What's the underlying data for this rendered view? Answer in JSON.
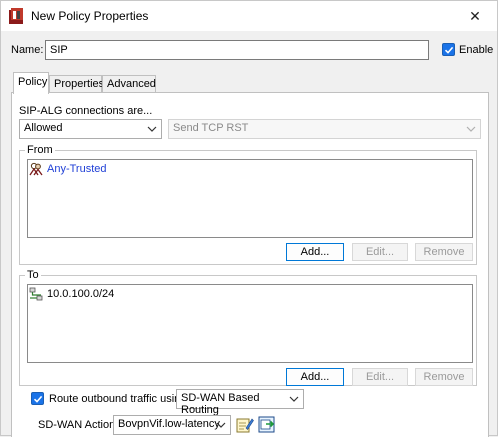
{
  "window": {
    "title": "New Policy Properties",
    "close_glyph": "✕",
    "app_icon": "policy-app-icon"
  },
  "name_field": {
    "label": "Name:",
    "value": "SIP"
  },
  "enable": {
    "label": "Enable",
    "checked": true
  },
  "tabs": [
    {
      "label": "Policy",
      "active": true
    },
    {
      "label": "Properties",
      "active": false
    },
    {
      "label": "Advanced",
      "active": false
    }
  ],
  "policy": {
    "alg_label": "SIP-ALG connections are...",
    "connection_action": "Allowed",
    "tcp_rst": "Send TCP RST",
    "from": {
      "legend": "From",
      "items": [
        {
          "label": "Any-Trusted",
          "icon": "alias-group-icon",
          "color": "#1f3fd6"
        }
      ],
      "buttons": {
        "add": "Add...",
        "edit": "Edit...",
        "remove": "Remove"
      }
    },
    "to": {
      "legend": "To",
      "items": [
        {
          "label": "10.0.100.0/24",
          "icon": "network-icon"
        }
      ],
      "buttons": {
        "add": "Add...",
        "edit": "Edit...",
        "remove": "Remove"
      }
    },
    "route": {
      "label": "Route outbound traffic using",
      "checked": true,
      "method": "SD-WAN Based Routing"
    },
    "sdwan": {
      "label": "SD-WAN Action",
      "value": "BovpnVif.low-latency"
    }
  },
  "colors": {
    "accent": "#1a73e8",
    "link_blue": "#1f3fd6"
  }
}
